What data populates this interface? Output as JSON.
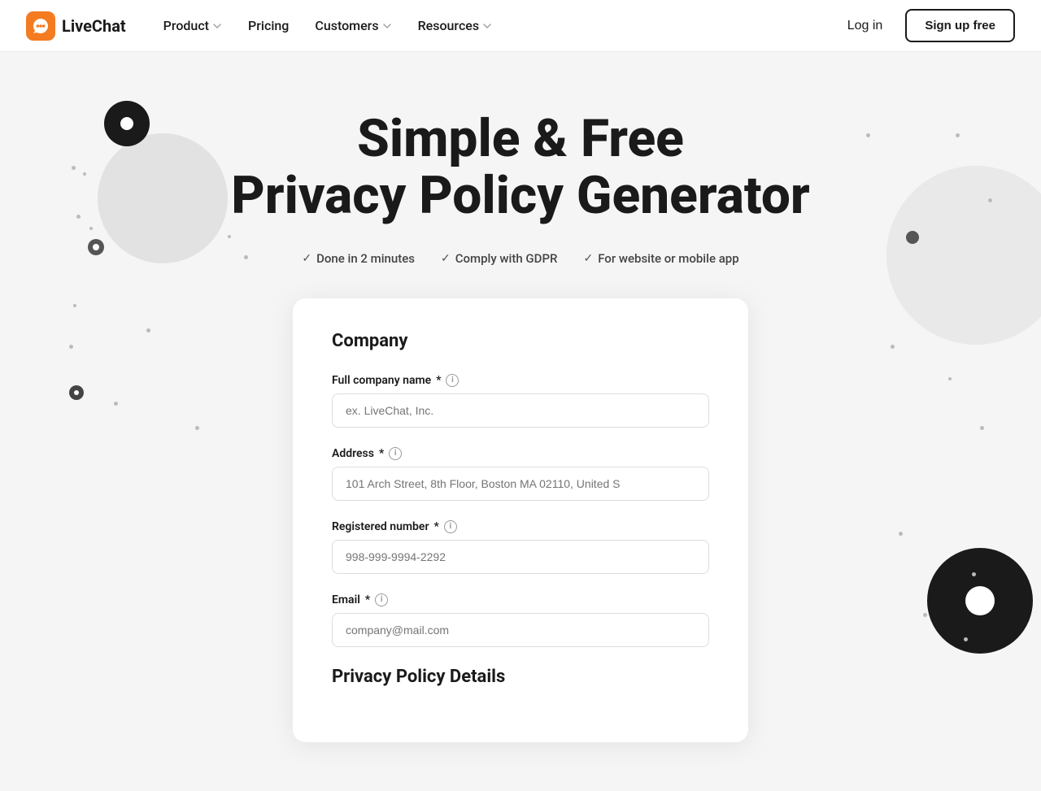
{
  "nav": {
    "logo_text": "LiveChat",
    "links": [
      {
        "label": "Product",
        "has_dropdown": true
      },
      {
        "label": "Pricing",
        "has_dropdown": false
      },
      {
        "label": "Customers",
        "has_dropdown": true
      },
      {
        "label": "Resources",
        "has_dropdown": true
      }
    ],
    "login_label": "Log in",
    "signup_label": "Sign up free"
  },
  "hero": {
    "title_line1": "Simple & Free",
    "title_line2": "Privacy Policy Generator",
    "features": [
      {
        "text": "Done in 2 minutes"
      },
      {
        "text": "Comply with GDPR"
      },
      {
        "text": "For website or mobile app"
      }
    ]
  },
  "form": {
    "company_section_title": "Company",
    "fields": [
      {
        "id": "full-company-name",
        "label": "Full company name",
        "required": true,
        "info": true,
        "placeholder": "ex. LiveChat, Inc."
      },
      {
        "id": "address",
        "label": "Address",
        "required": true,
        "info": true,
        "placeholder": "101 Arch Street, 8th Floor, Boston MA 02110, United S"
      },
      {
        "id": "registered-number",
        "label": "Registered number",
        "required": true,
        "info": true,
        "placeholder": "998-999-9994-2292"
      },
      {
        "id": "email",
        "label": "Email",
        "required": true,
        "info": true,
        "placeholder": "company@mail.com"
      }
    ],
    "privacy_section_title": "Privacy Policy Details"
  }
}
